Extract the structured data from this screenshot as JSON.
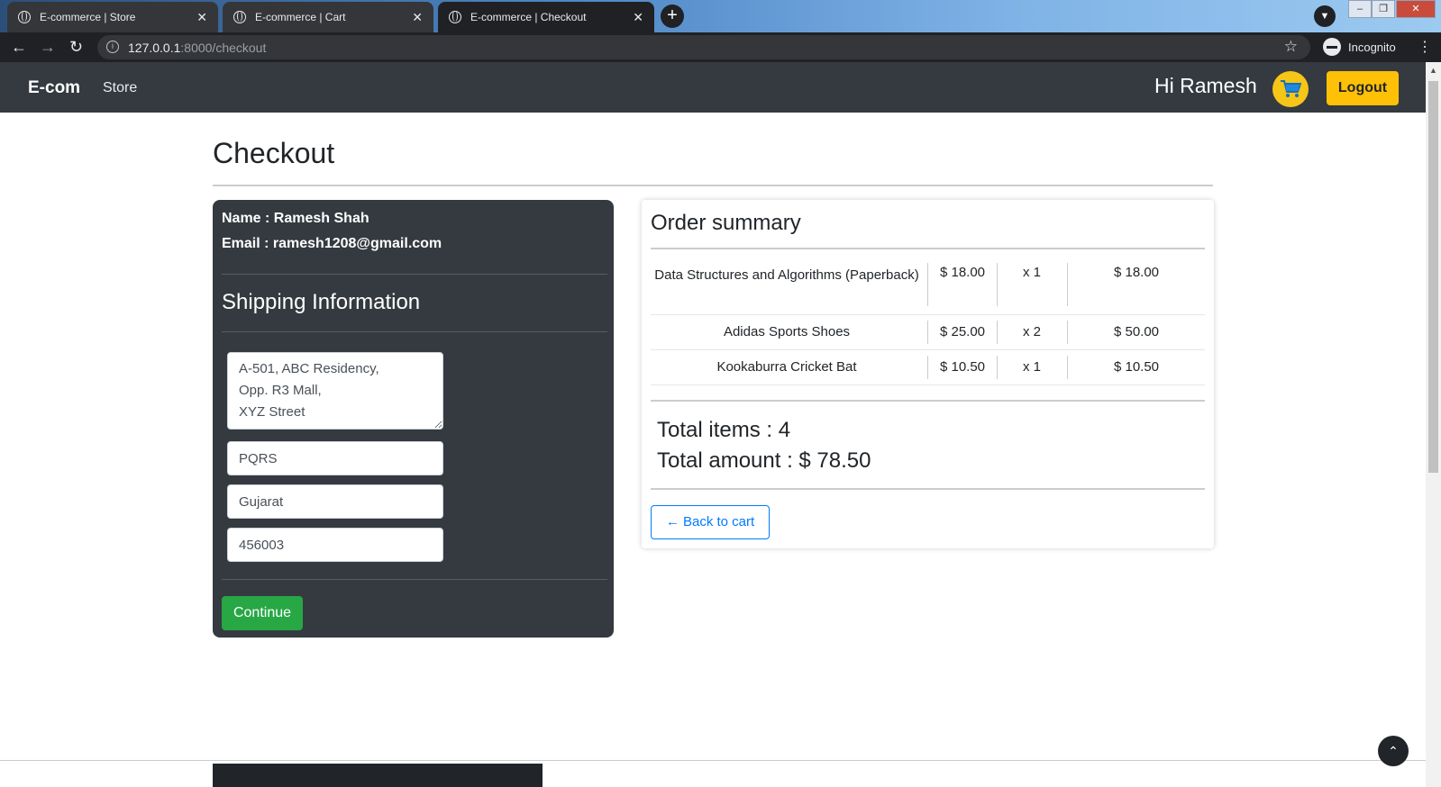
{
  "browser": {
    "tabs": [
      {
        "title": "E-commerce | Store"
      },
      {
        "title": "E-commerce | Cart"
      },
      {
        "title": "E-commerce | Checkout"
      }
    ],
    "url_host": "127.0.0.1",
    "url_path": ":8000/checkout",
    "incognito_label": "Incognito"
  },
  "navbar": {
    "brand": "E-com",
    "store_link": "Store",
    "greeting": "Hi Ramesh",
    "logout_label": "Logout",
    "accent_color": "#ffc107"
  },
  "page": {
    "title": "Checkout"
  },
  "user_info": {
    "name_line": "Name : Ramesh Shah",
    "email_line": "Email : ramesh1208@gmail.com"
  },
  "shipping": {
    "heading": "Shipping Information",
    "address": "A-501, ABC Residency,\nOpp. R3 Mall,\nXYZ Street",
    "city": "PQRS",
    "state": "Gujarat",
    "zipcode": "456003",
    "continue_label": "Continue"
  },
  "order_summary": {
    "heading": "Order summary",
    "items": [
      {
        "name": "Data Structures and Algorithms (Paperback)",
        "price": "$ 18.00",
        "qty": "x 1",
        "total": "$ 18.00"
      },
      {
        "name": "Adidas Sports Shoes",
        "price": "$ 25.00",
        "qty": "x 2",
        "total": "$ 50.00"
      },
      {
        "name": "Kookaburra Cricket Bat",
        "price": "$ 10.50",
        "qty": "x 1",
        "total": "$ 10.50"
      }
    ],
    "total_items": "Total items : 4",
    "total_amount": "Total amount : $ 78.50",
    "back_label": "Back to cart"
  }
}
